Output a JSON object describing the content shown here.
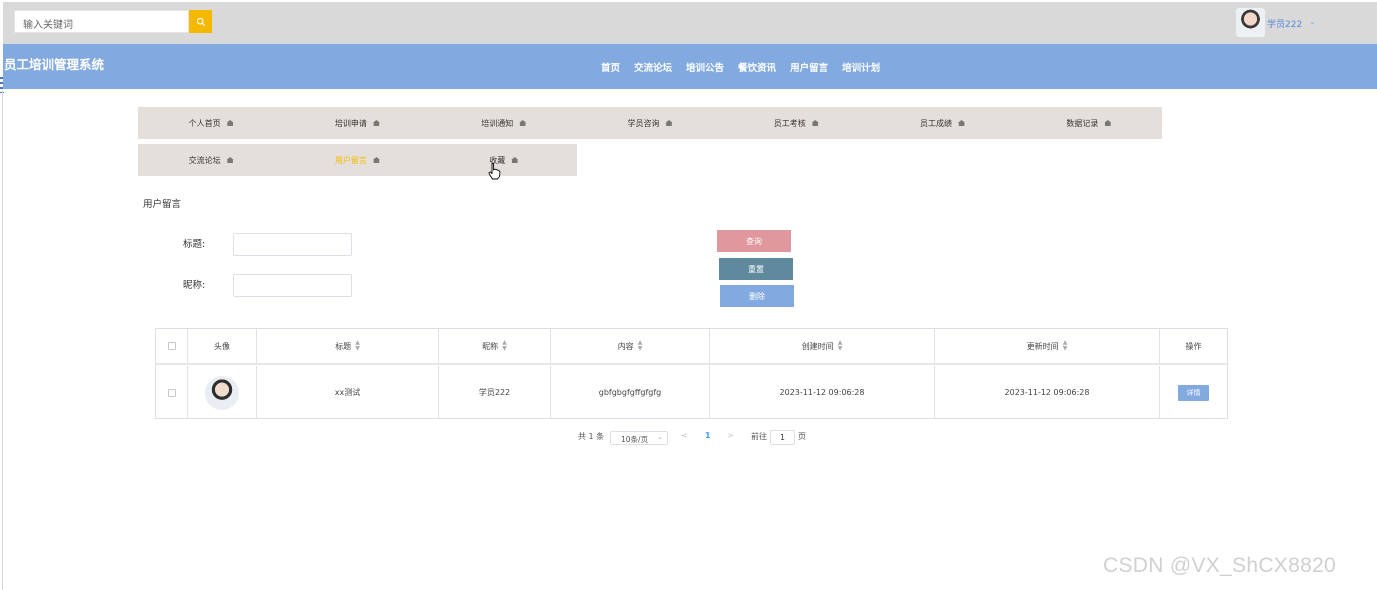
{
  "topbar": {
    "search_placeholder": "输入关键词",
    "user_name": "学员222",
    "user_caret": "⌄"
  },
  "navbar": {
    "system_title": "员工培训管理系统",
    "menu": [
      "首页",
      "交流论坛",
      "培训公告",
      "餐饮资讯",
      "用户留言",
      "培训计划"
    ]
  },
  "tabs": {
    "row1": [
      "个人首页",
      "培训申请",
      "培训通知",
      "学员咨询",
      "员工考核",
      "员工成绩",
      "数据记录"
    ],
    "row2": [
      "交流论坛",
      "用户留言",
      "收藏"
    ],
    "active": "用户留言"
  },
  "section_title": "用户留言",
  "search_form": {
    "title_label": "标题:",
    "nickname_label": "昵称:",
    "title_value": "",
    "nickname_value": ""
  },
  "buttons": {
    "query": "查询",
    "reset": "重置",
    "delete": "删除"
  },
  "table": {
    "headers": [
      "头像",
      "标题",
      "昵称",
      "内容",
      "创建时间",
      "更新时间",
      "操作"
    ],
    "rows": [
      {
        "title": "xx测试",
        "nickname": "学员222",
        "content": "gbfgbgfgffgfgfg",
        "created": "2023-11-12 09:06:28",
        "updated": "2023-11-12 09:06:28",
        "action": "详情"
      }
    ]
  },
  "pagination": {
    "total": "共 1 条",
    "page_size": "10条/页",
    "prev": "<",
    "current_page": "1",
    "next": ">",
    "goto_label": "前往",
    "goto_value": "1",
    "page_suffix": "页"
  },
  "watermark": "CSDN @VX_ShCX8820"
}
